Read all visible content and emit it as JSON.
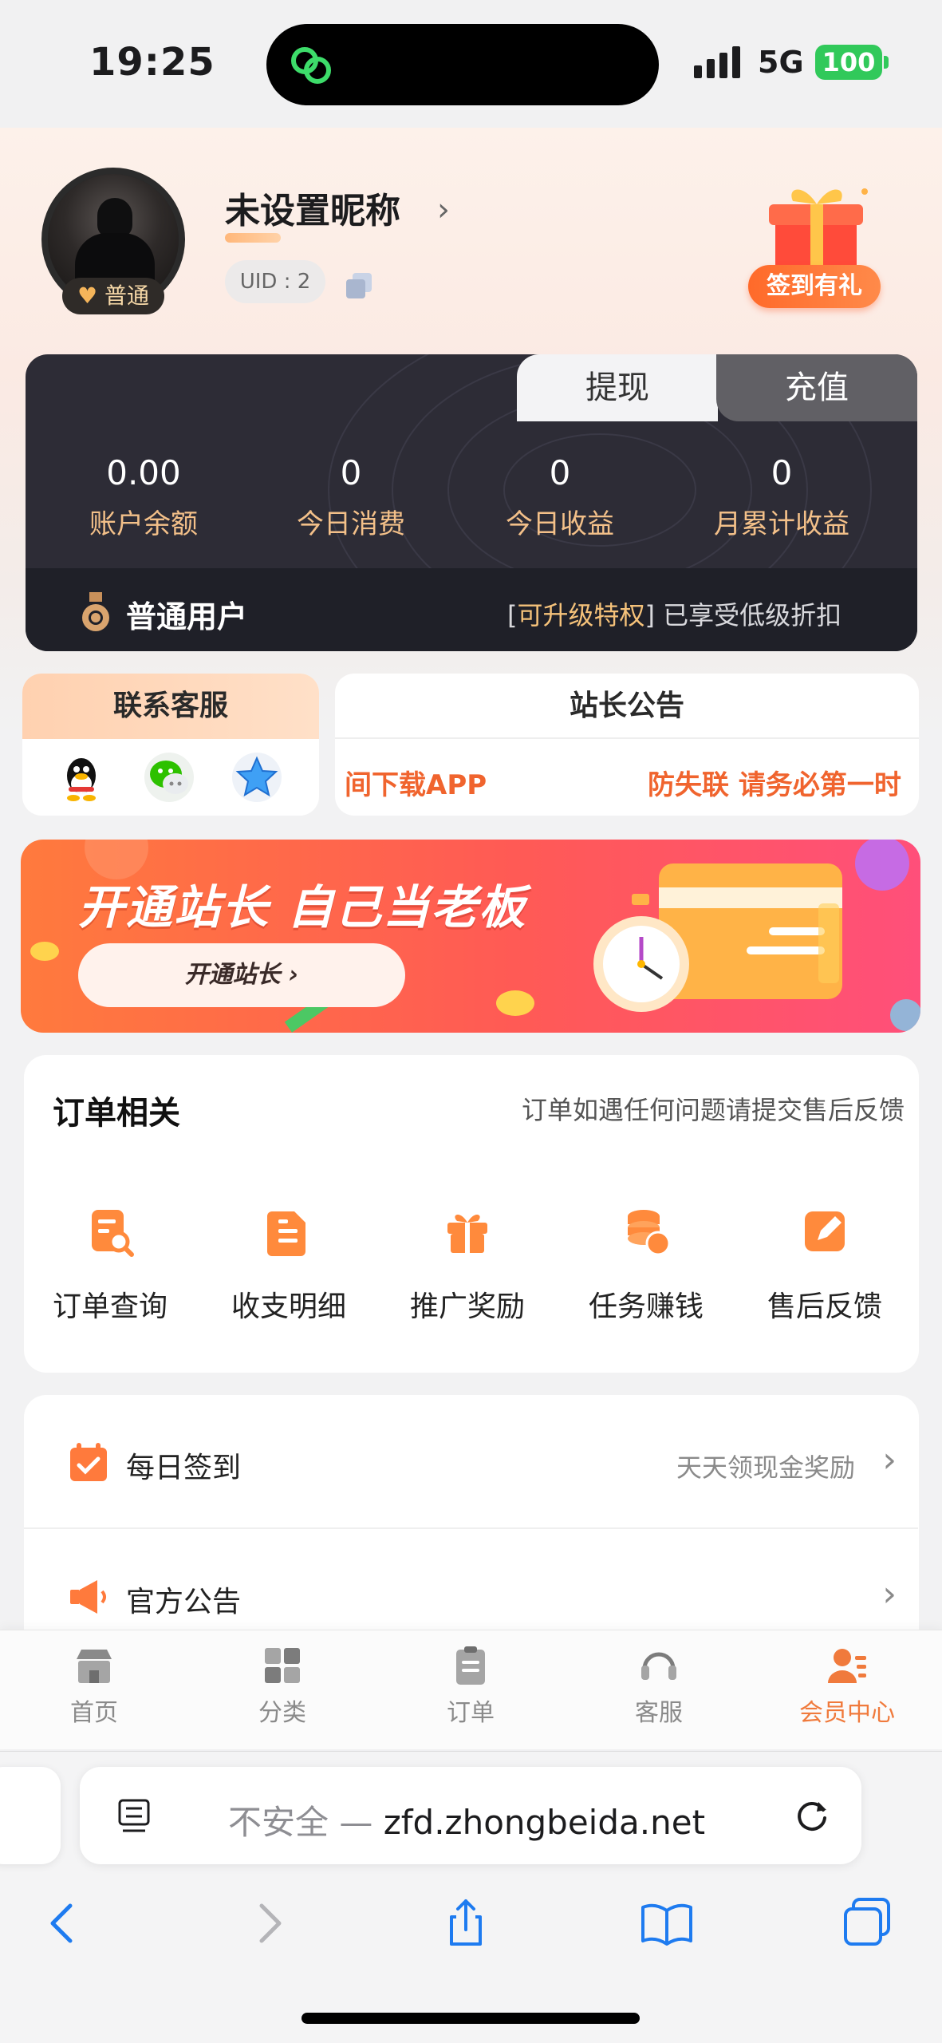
{
  "status_bar": {
    "time": "19:25",
    "network": "5G",
    "battery": "100"
  },
  "profile": {
    "nickname": "未设置昵称",
    "uid_label": "UID : 2",
    "level_badge": "普通",
    "sign_in_gift": "签到有礼"
  },
  "wallet": {
    "tabs": {
      "withdraw": "提现",
      "recharge": "充值"
    },
    "stats": [
      {
        "value": "0.00",
        "label": "账户余额"
      },
      {
        "value": "0",
        "label": "今日消费"
      },
      {
        "value": "0",
        "label": "今日收益"
      },
      {
        "value": "0",
        "label": "月累计收益"
      }
    ],
    "user_type": "普通用户",
    "upgrade_open": "[",
    "upgrade_link": "可升级特权",
    "upgrade_rest": "] 已享受低级折扣"
  },
  "service": {
    "title": "联系客服",
    "icons": [
      "qq-icon",
      "wechat-icon",
      "star-icon"
    ]
  },
  "notice": {
    "title": "站长公告",
    "scroll_left": "间下载APP",
    "scroll_right": "防失联 请务必第一时"
  },
  "banner": {
    "title": "开通站长  自己当老板",
    "button": "开通站长 ›"
  },
  "orders": {
    "title": "订单相关",
    "hint": "订单如遇任何问题请提交售后反馈",
    "items": [
      {
        "label": "订单查询",
        "icon": "order-search-icon"
      },
      {
        "label": "收支明细",
        "icon": "document-icon"
      },
      {
        "label": "推广奖励",
        "icon": "gift-icon"
      },
      {
        "label": "任务赚钱",
        "icon": "coins-icon"
      },
      {
        "label": "售后反馈",
        "icon": "edit-icon"
      }
    ]
  },
  "list": [
    {
      "label": "每日签到",
      "right": "天天领现金奖励",
      "icon": "calendar-check-icon"
    },
    {
      "label": "官方公告",
      "right": "",
      "icon": "megaphone-icon"
    }
  ],
  "tabbar": {
    "items": [
      {
        "label": "首页",
        "icon": "store-icon"
      },
      {
        "label": "分类",
        "icon": "grid-icon"
      },
      {
        "label": "订单",
        "icon": "clipboard-icon"
      },
      {
        "label": "客服",
        "icon": "headset-icon"
      },
      {
        "label": "会员中心",
        "icon": "member-icon"
      }
    ],
    "active_index": 4
  },
  "browser": {
    "insecure": "不安全 — ",
    "host": "zfd.zhongbeida.net"
  },
  "colors": {
    "accent": "#f07a3c",
    "gold": "#f3c089",
    "wallet_bg": "#2d2c36"
  }
}
